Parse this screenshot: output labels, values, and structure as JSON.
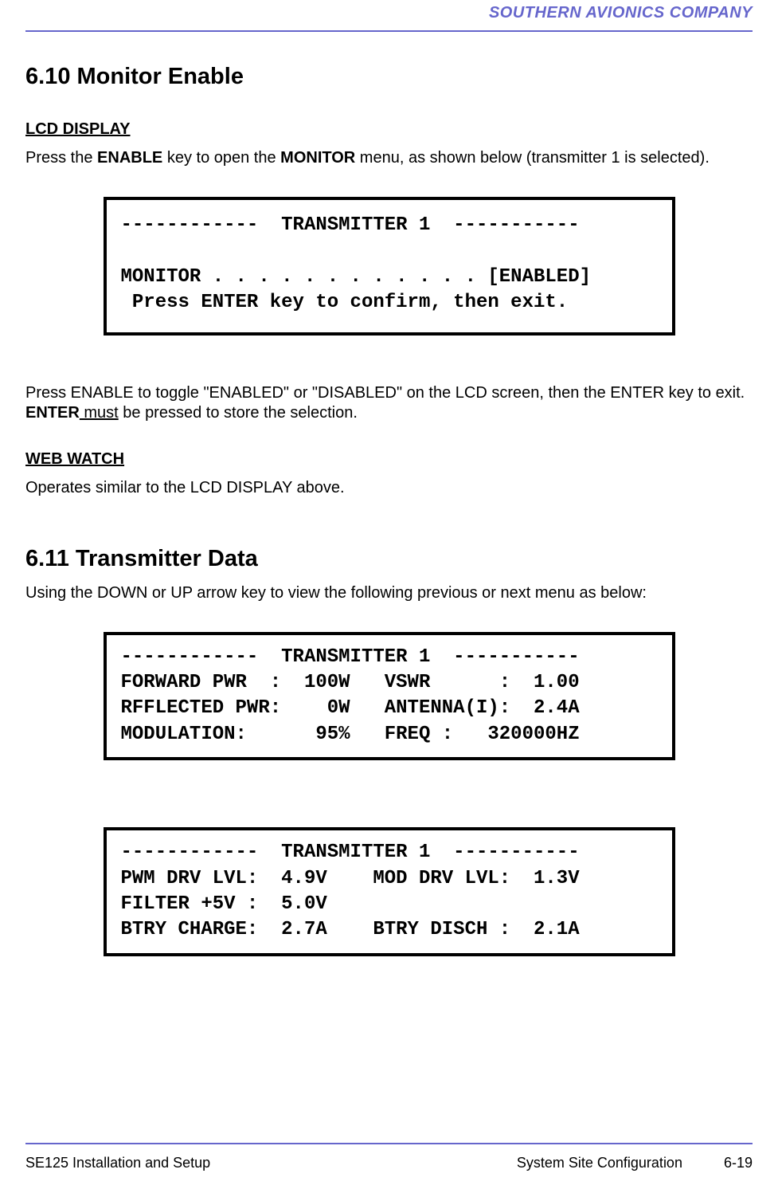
{
  "header": {
    "company": "SOUTHERN AVIONICS COMPANY"
  },
  "section610": {
    "title": "6.10  Monitor Enable",
    "lcd_heading": "LCD DISPLAY",
    "intro_pre": "Press the ",
    "intro_b1": "ENABLE",
    "intro_mid": " key to open the ",
    "intro_b2": "MONITOR",
    "intro_post": " menu, as shown below (transmitter 1 is selected).",
    "lcd_box": "------------  TRANSMITTER 1  -----------\n\nMONITOR . . . . . . . . . . . . [ENABLED]\n Press ENTER key to confirm, then exit.",
    "toggle_pre": "Press  ENABLE to toggle \"ENABLED\" or \"DISABLED\" on the LCD screen, then the ENTER key to exit.  ",
    "toggle_b": "ENTER",
    "toggle_u": " must",
    "toggle_post": " be pressed to store the selection.",
    "web_heading": "WEB WATCH",
    "web_text": "Operates similar to the LCD DISPLAY above."
  },
  "section611": {
    "title": "6.11  Transmitter Data",
    "intro": "Using the DOWN or UP arrow key to view the following previous or next menu as below:",
    "lcd_box_1": "------------  TRANSMITTER 1  -----------\nFORWARD PWR  :  100W   VSWR      :  1.00\nRFFLECTED PWR:    0W   ANTENNA(I):  2.4A\nMODULATION:      95%   FREQ :   320000HZ",
    "lcd_box_2": "------------  TRANSMITTER 1  -----------\nPWM DRV LVL:  4.9V    MOD DRV LVL:  1.3V\nFILTER +5V :  5.0V\nBTRY CHARGE:  2.7A    BTRY DISCH :  2.1A"
  },
  "footer": {
    "left": "SE125 Installation and Setup",
    "center": "System Site Configuration",
    "page": "6-19"
  }
}
